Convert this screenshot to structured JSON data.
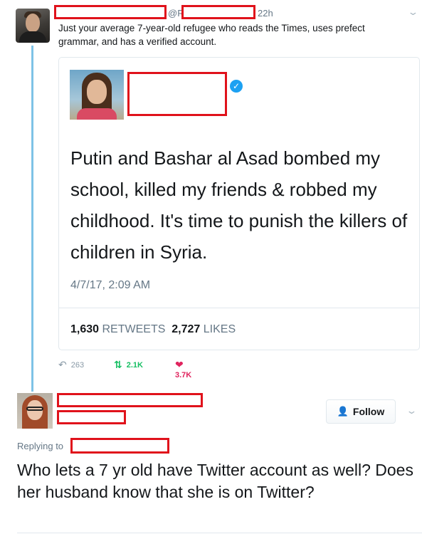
{
  "tweet1": {
    "handle_prefix": "@R",
    "time": "22h",
    "text": "Just your average 7-year-old refugee who reads the Times, uses prefect grammar, and has a verified account."
  },
  "quoted": {
    "text": "Putin and Bashar al Asad bombed my school, killed my friends & robbed my childhood. It's time to punish the killers of children in Syria.",
    "date": "4/7/17, 2:09 AM",
    "retweets_count": "1,630",
    "retweets_label": "RETWEETS",
    "likes_count": "2,727",
    "likes_label": "LIKES"
  },
  "actions": {
    "replies": "263",
    "retweets": "2.1K",
    "likes": "3.7K"
  },
  "tweet2": {
    "follow_label": "Follow",
    "replying_to": "Replying to",
    "text": "Who lets a 7 yr old have Twitter account as well? Does her husband know that she is on Twitter?"
  },
  "icons": {
    "verified": "verified-badge-icon",
    "reply": "reply-icon",
    "retweet": "retweet-icon",
    "like": "heart-icon",
    "follow": "follow-person-icon",
    "more": "chevron-down-icon"
  },
  "colors": {
    "thread_line": "#7ec3e6",
    "redaction": "#e0121b",
    "verified": "#1da1f2",
    "retweet": "#17bf63",
    "like": "#e0245e",
    "muted": "#657786"
  }
}
